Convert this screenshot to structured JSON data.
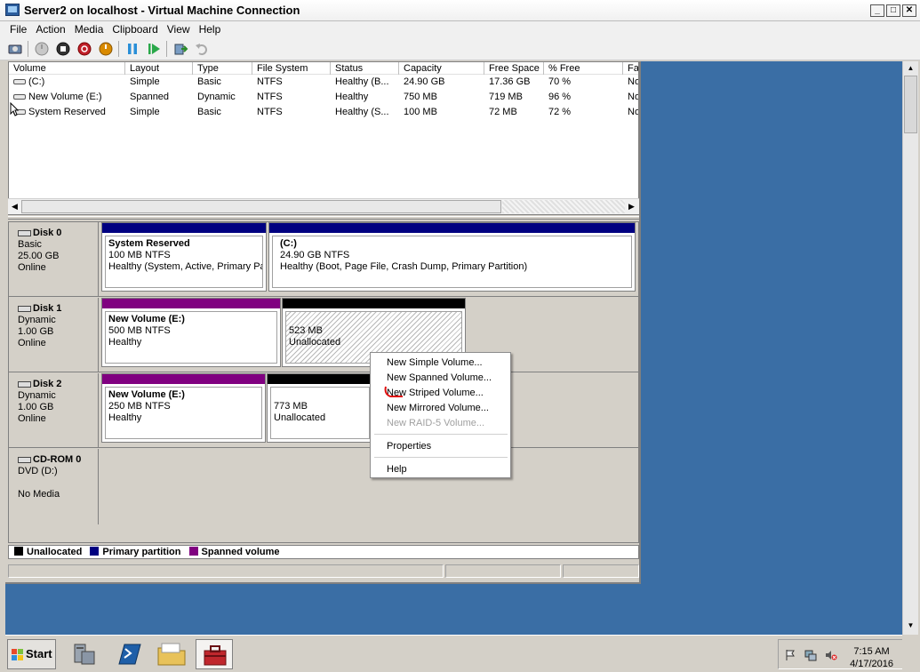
{
  "window": {
    "title": "Server2 on localhost - Virtual Machine Connection",
    "minimize": "_",
    "maximize": "□",
    "close": "✕"
  },
  "menubar": [
    "File",
    "Action",
    "Media",
    "Clipboard",
    "View",
    "Help"
  ],
  "volume_table": {
    "columns": [
      "Volume",
      "Layout",
      "Type",
      "File System",
      "Status",
      "Capacity",
      "Free Space",
      "% Free",
      "Fa"
    ],
    "rows": [
      [
        "(C:)",
        "Simple",
        "Basic",
        "NTFS",
        "Healthy (B...",
        "24.90 GB",
        "17.36 GB",
        "70 %",
        "No"
      ],
      [
        "New Volume (E:)",
        "Spanned",
        "Dynamic",
        "NTFS",
        "Healthy",
        "750 MB",
        "719 MB",
        "96 %",
        "No"
      ],
      [
        "System Reserved",
        "Simple",
        "Basic",
        "NTFS",
        "Healthy (S...",
        "100 MB",
        "72 MB",
        "72 %",
        "No"
      ]
    ]
  },
  "disks": [
    {
      "name": "Disk 0",
      "type": "Basic",
      "size": "25.00 GB",
      "state": "Online",
      "partitions": [
        {
          "title": "System Reserved",
          "size": "100 MB NTFS",
          "status": "Healthy (System, Active, Primary Pa",
          "kind": "primary"
        },
        {
          "title": "(C:)",
          "size": "24.90 GB NTFS",
          "status": "Healthy (Boot, Page File, Crash Dump, Primary Partition)",
          "kind": "primary"
        }
      ]
    },
    {
      "name": "Disk 1",
      "type": "Dynamic",
      "size": "1.00 GB",
      "state": "Online",
      "partitions": [
        {
          "title": "New Volume  (E:)",
          "size": "500 MB NTFS",
          "status": "Healthy",
          "kind": "spanned"
        },
        {
          "title": "",
          "size": "523 MB",
          "status": "Unallocated",
          "kind": "unallocated"
        }
      ]
    },
    {
      "name": "Disk 2",
      "type": "Dynamic",
      "size": "1.00 GB",
      "state": "Online",
      "partitions": [
        {
          "title": "New Volume  (E:)",
          "size": "250 MB NTFS",
          "status": "Healthy",
          "kind": "spanned"
        },
        {
          "title": "",
          "size": "773 MB",
          "status": "Unallocated",
          "kind": "unallocated"
        }
      ]
    },
    {
      "name": "CD-ROM 0",
      "type": "DVD (D:)",
      "size": "",
      "state": "No Media",
      "partitions": []
    }
  ],
  "legend": {
    "items": [
      {
        "label": "Unallocated",
        "color": "#000000"
      },
      {
        "label": "Primary partition",
        "color": "#000080"
      },
      {
        "label": "Spanned volume",
        "color": "#800080"
      }
    ]
  },
  "context_menu": {
    "items": [
      {
        "label": "New Simple Volume...",
        "enabled": true
      },
      {
        "label": "New Spanned Volume...",
        "enabled": true
      },
      {
        "label": "New Striped Volume...",
        "enabled": true
      },
      {
        "label": "New Mirrored Volume...",
        "enabled": true
      },
      {
        "label": "New RAID-5 Volume...",
        "enabled": false
      },
      {
        "label": "Properties",
        "enabled": true
      },
      {
        "label": "Help",
        "enabled": true
      }
    ]
  },
  "taskbar": {
    "start_label": "Start",
    "time": "7:15 AM",
    "date": "4/17/2016"
  },
  "colors": {
    "desktop": "#3a6ea5",
    "primary": "#000080",
    "spanned": "#800080",
    "unallocated": "#000000",
    "annotation": "#e01010"
  }
}
